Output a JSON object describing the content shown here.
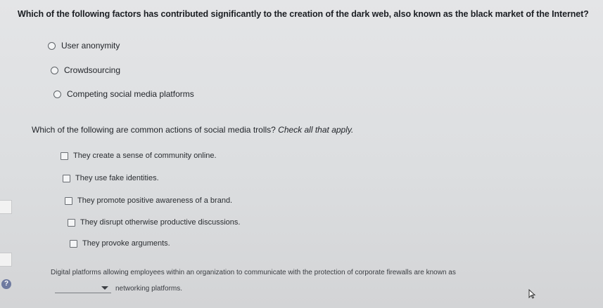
{
  "question1": {
    "text": "Which of the following factors has contributed significantly to the creation of the dark web, also known as the black market of the Internet?",
    "options": [
      "User anonymity",
      "Crowdsourcing",
      "Competing social media platforms"
    ]
  },
  "question2": {
    "text": "Which of the following are common actions of social media trolls? ",
    "hint": "Check all that apply.",
    "options": [
      "They create a sense of community online.",
      "They use fake identities.",
      "They promote positive awareness of a brand.",
      "They disrupt otherwise productive discussions.",
      "They provoke arguments."
    ]
  },
  "question3": {
    "text": "Digital platforms allowing employees within an organization to communicate with the protection of corporate firewalls are known as",
    "suffix": "networking platforms.",
    "selected_value": ""
  },
  "help": {
    "label": "?"
  },
  "icons": {
    "help": "help-icon",
    "cursor": "mouse-pointer-icon",
    "dropdown": "chevron-down-icon"
  }
}
